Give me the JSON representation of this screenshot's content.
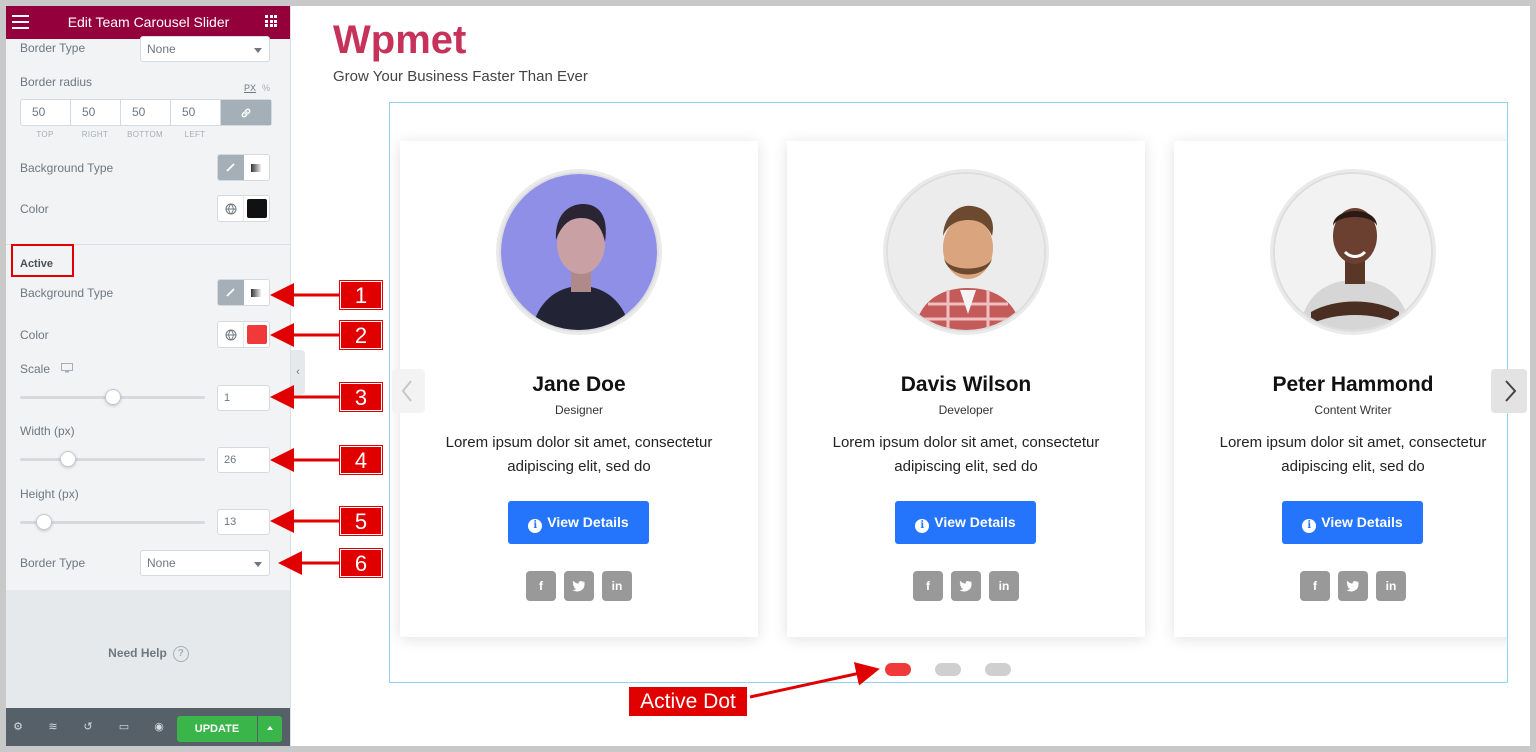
{
  "panel": {
    "title": "Edit Team Carousel Slider",
    "border_type_label": "Border Type",
    "border_type_value": "None",
    "border_radius_label": "Border radius",
    "unit_px": "PX",
    "unit_pct": "%",
    "radius": {
      "top": "50",
      "right": "50",
      "bottom": "50",
      "left": "50"
    },
    "radius_labels": {
      "top": "TOP",
      "right": "RIGHT",
      "bottom": "BOTTOM",
      "left": "LEFT"
    },
    "background_type_label": "Background Type",
    "color_label": "Color",
    "normal_color": "#111111",
    "active_section": "Active",
    "active_background_type_label": "Background Type",
    "active_color_label": "Color",
    "active_color": "#f03a3a",
    "scale_label": "Scale",
    "scale_value": "1",
    "scale_fraction": 0.5,
    "width_label": "Width (px)",
    "width_value": "26",
    "width_fraction": 0.26,
    "height_label": "Height (px)",
    "height_value": "13",
    "height_fraction": 0.13,
    "active_border_type_label": "Border Type",
    "active_border_type_value": "None",
    "need_help": "Need Help",
    "update_label": "UPDATE"
  },
  "preview": {
    "brand": "Wpmet",
    "tagline": "Grow Your Business Faster Than Ever",
    "cards": [
      {
        "name": "Jane Doe",
        "role": "Designer",
        "desc": "Lorem ipsum dolor sit amet, consectetur adipiscing elit, sed do",
        "button": "View Details"
      },
      {
        "name": "Davis Wilson",
        "role": "Developer",
        "desc": "Lorem ipsum dolor sit amet, consectetur adipiscing elit, sed do",
        "button": "View Details"
      },
      {
        "name": "Peter Hammond",
        "role": "Content Writer",
        "desc": "Lorem ipsum dolor sit amet, consectetur adipiscing elit, sed do",
        "button": "View Details"
      }
    ],
    "social": {
      "facebook": "f",
      "twitter": "t",
      "linkedin": "in"
    },
    "dots": {
      "count": 3,
      "active_index": 0,
      "active_color": "#f03a3a",
      "inactive_color": "#cfcfcf"
    }
  },
  "annotations": {
    "numbers": [
      "1",
      "2",
      "3",
      "4",
      "5",
      "6"
    ],
    "active_dot_label": "Active Dot"
  },
  "colors": {
    "header": "#93003c",
    "brand": "#c6325a",
    "button": "#2575fc",
    "update": "#39b54a",
    "annotation": "#e10000"
  }
}
